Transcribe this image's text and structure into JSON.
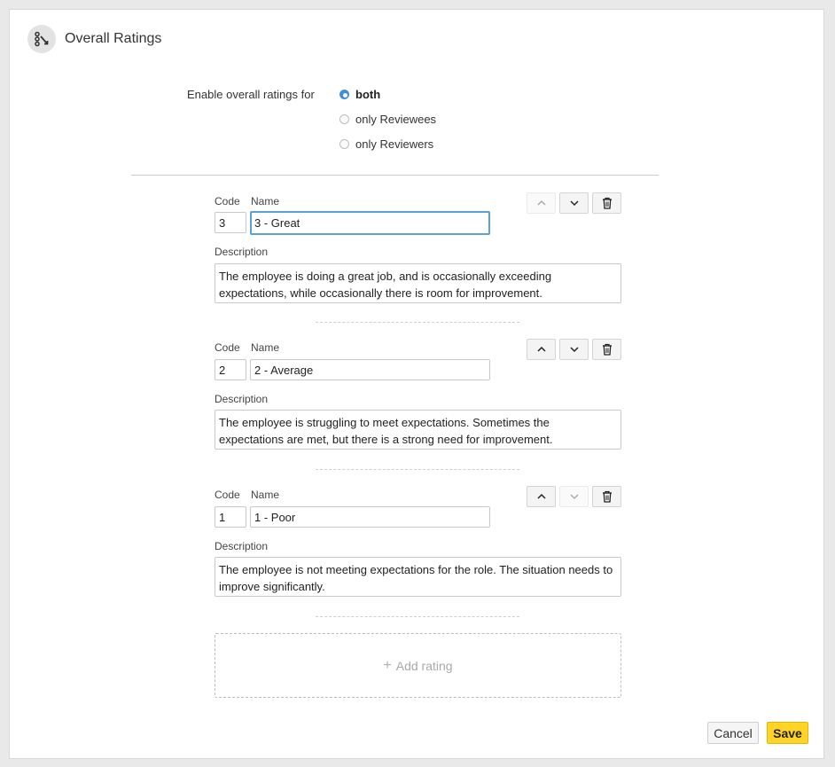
{
  "header": {
    "title": "Overall Ratings",
    "icon": "overall-ratings-icon"
  },
  "enable": {
    "label": "Enable overall ratings for",
    "options": [
      {
        "label": "both",
        "selected": true
      },
      {
        "label": "only Reviewees",
        "selected": false
      },
      {
        "label": "only Reviewers",
        "selected": false
      }
    ]
  },
  "fields": {
    "code_label": "Code",
    "name_label": "Name",
    "description_label": "Description"
  },
  "ratings": [
    {
      "code": "3",
      "name": "3 - Great",
      "description": "The employee is doing a great job, and is occasionally exceeding expectations, while occasionally there is room for improvement.",
      "move_up_enabled": false,
      "move_down_enabled": true
    },
    {
      "code": "2",
      "name": "2 - Average",
      "description": "The employee is struggling to meet expectations. Sometimes the expectations are met, but there is a strong need for improvement.",
      "move_up_enabled": true,
      "move_down_enabled": true
    },
    {
      "code": "1",
      "name": "1 - Poor",
      "description": "The employee is not meeting expectations for the role. The situation needs to improve significantly.",
      "move_up_enabled": true,
      "move_down_enabled": false
    }
  ],
  "add_rating": {
    "label": "Add rating",
    "icon": "plus-icon"
  },
  "footer": {
    "cancel_label": "Cancel",
    "save_label": "Save"
  },
  "colors": {
    "accent": "#3d8fd8",
    "save": "#ffd426",
    "focus": "#5aa0d9"
  }
}
